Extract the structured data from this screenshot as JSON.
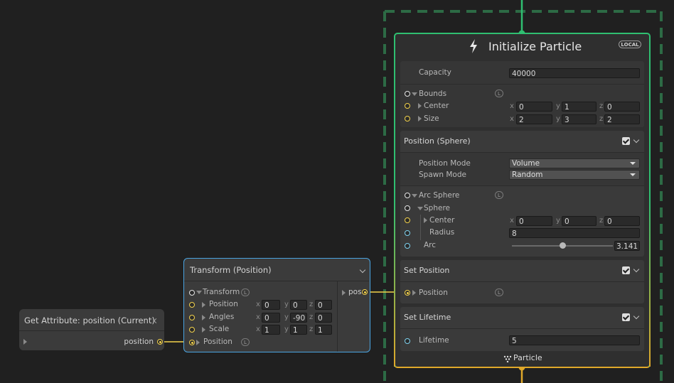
{
  "get_attribute": {
    "title": "Get Attribute: position (Current)",
    "output_label": "position"
  },
  "transform": {
    "title": "Transform (Position)",
    "out_label": "pos",
    "rows": {
      "transform": "Transform",
      "position": "Position",
      "angles": "Angles",
      "scale": "Scale",
      "position_input": "Position"
    },
    "position": {
      "x": "0",
      "y": "0",
      "z": "0"
    },
    "angles": {
      "x": "0",
      "y": "-90",
      "z": "0"
    },
    "scale": {
      "x": "1",
      "y": "1",
      "z": "1"
    }
  },
  "initialize": {
    "title": "Initialize Particle",
    "badge": "LOCAL",
    "capacity_label": "Capacity",
    "capacity_value": "40000",
    "bounds_label": "Bounds",
    "center_label": "Center",
    "size_label": "Size",
    "bounds_center": {
      "x": "0",
      "y": "1",
      "z": "0"
    },
    "bounds_size": {
      "x": "2",
      "y": "3",
      "z": "2"
    },
    "footer_label": "Particle"
  },
  "position_sphere": {
    "title": "Position (Sphere)",
    "enabled": true,
    "position_mode_label": "Position Mode",
    "position_mode_value": "Volume",
    "spawn_mode_label": "Spawn Mode",
    "spawn_mode_value": "Random",
    "arc_sphere_label": "Arc Sphere",
    "sphere_label": "Sphere",
    "center_label": "Center",
    "center": {
      "x": "0",
      "y": "0",
      "z": "0"
    },
    "radius_label": "Radius",
    "radius_value": "8",
    "arc_label": "Arc",
    "arc_value": "3.141",
    "arc_fraction": 0.5
  },
  "set_position": {
    "title": "Set Position",
    "enabled": true,
    "position_label": "Position"
  },
  "set_lifetime": {
    "title": "Set Lifetime",
    "enabled": true,
    "lifetime_label": "Lifetime",
    "lifetime_value": "5"
  },
  "axes": {
    "x": "x",
    "y": "y",
    "z": "z"
  },
  "link_badge": "L",
  "colors": {
    "background": "#202020",
    "node": "#3b3b3b",
    "context_border_top": "#2fbf71",
    "context_border_bottom": "#e0a82a",
    "selection": "#4aa3e0",
    "wire_yellow": "#f3d24b",
    "system_dash": "#2d6b45"
  }
}
